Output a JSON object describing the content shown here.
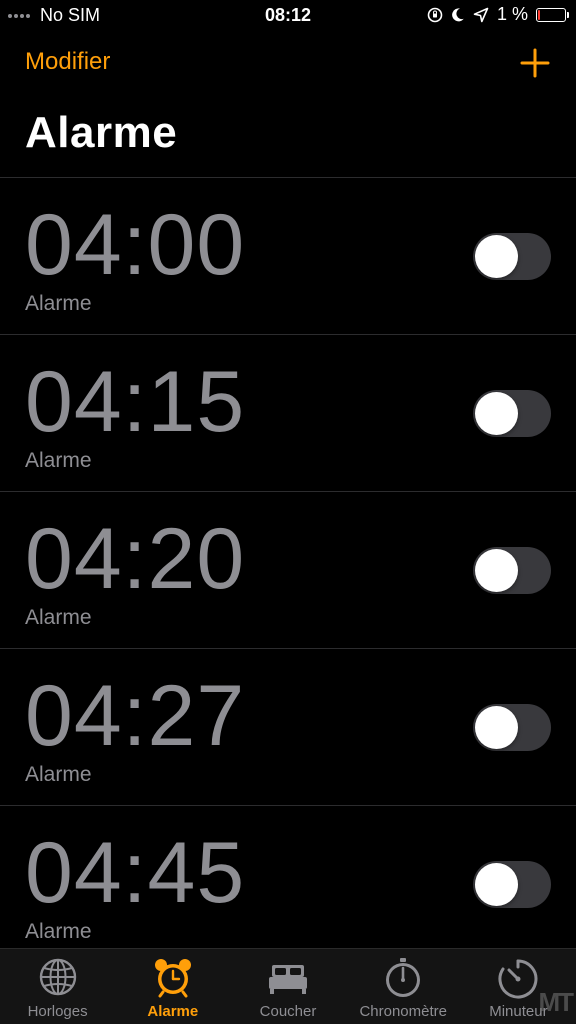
{
  "status_bar": {
    "carrier": "No SIM",
    "time": "08:12",
    "battery_percent": "1 %",
    "battery_level": 0.01,
    "battery_color": "#ff3b30"
  },
  "nav": {
    "edit_label": "Modifier",
    "add_icon": "plus-icon",
    "accent_color": "#ff9f0a"
  },
  "title": "Alarme",
  "alarms": [
    {
      "time": "04:00",
      "label": "Alarme",
      "enabled": false
    },
    {
      "time": "04:15",
      "label": "Alarme",
      "enabled": false
    },
    {
      "time": "04:20",
      "label": "Alarme",
      "enabled": false
    },
    {
      "time": "04:27",
      "label": "Alarme",
      "enabled": false
    },
    {
      "time": "04:45",
      "label": "Alarme",
      "enabled": false
    }
  ],
  "tabs": [
    {
      "label": "Horloges",
      "icon": "globe-icon",
      "active": false
    },
    {
      "label": "Alarme",
      "icon": "alarm-clock-icon",
      "active": true
    },
    {
      "label": "Coucher",
      "icon": "bed-icon",
      "active": false
    },
    {
      "label": "Chronomètre",
      "icon": "stopwatch-icon",
      "active": false
    },
    {
      "label": "Minuteur",
      "icon": "timer-icon",
      "active": false
    }
  ]
}
